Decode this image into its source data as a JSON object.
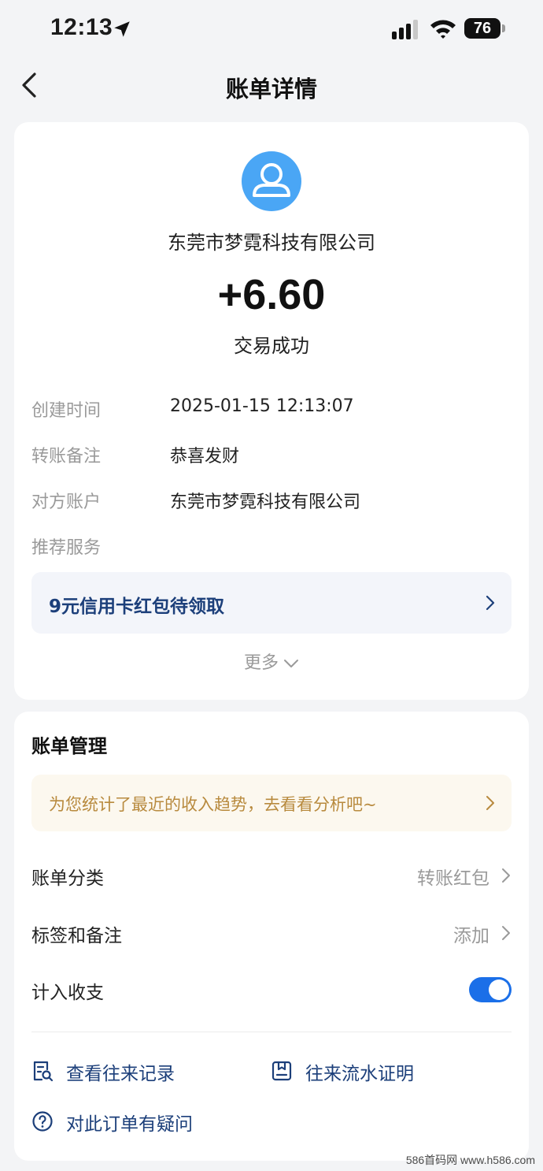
{
  "status_bar": {
    "time": "12:13",
    "battery": "76"
  },
  "nav": {
    "title": "账单详情"
  },
  "transaction": {
    "payee": "东莞市梦霓科技有限公司",
    "amount": "+6.60",
    "status": "交易成功",
    "details": [
      {
        "label": "创建时间",
        "value": "2025-01-15 12:13:07"
      },
      {
        "label": "转账备注",
        "value": "恭喜发财"
      },
      {
        "label": "对方账户",
        "value": "东莞市梦霓科技有限公司"
      },
      {
        "label": "推荐服务",
        "value": ""
      }
    ],
    "promo": "9元信用卡红包待领取",
    "more_label": "更多"
  },
  "management": {
    "title": "账单管理",
    "tip": "为您统计了最近的收入趋势，去看看分析吧~",
    "category": {
      "label": "账单分类",
      "value": "转账红包"
    },
    "tags": {
      "label": "标签和备注",
      "value": "添加"
    },
    "include": {
      "label": "计入收支",
      "enabled": true
    },
    "links": {
      "history": "查看往来记录",
      "proof": "往来流水证明",
      "question": "对此订单有疑问"
    }
  },
  "watermark": "586首码网 www.h586.com",
  "colors": {
    "accent": "#1b6fe8",
    "link": "#1c3f7a",
    "tip_text": "#b88a3e",
    "avatar": "#4aa6f5"
  }
}
